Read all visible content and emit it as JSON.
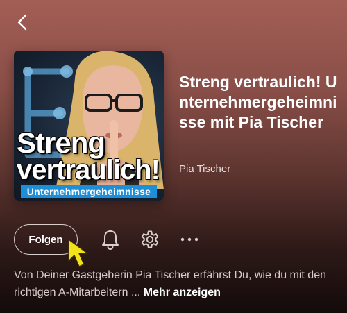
{
  "header": {
    "back_icon": "chevron-left-icon"
  },
  "cover": {
    "title_line1": "Streng",
    "title_line2": "vertraulich!",
    "subtitle": "Unternehmergeheimnisse",
    "band_color": "#1d8fd8"
  },
  "podcast": {
    "title": "Streng vertraulich! Unternehmergeheimnisse mit Pia Tischer",
    "author": "Pia Tischer"
  },
  "actions": {
    "follow_label": "Folgen",
    "bell_icon": "bell-icon",
    "settings_icon": "gear-icon",
    "more_icon": "more-horizontal-icon"
  },
  "description": {
    "text": "Von Deiner Gastgeberin Pia Tischer erfährst Du, wie du mit den richtigen A-Mitarbeitern ... ",
    "more_label": "Mehr anzeigen"
  },
  "colors": {
    "background_top": "#a25e55",
    "background_bottom": "#130b0a",
    "cursor": "#f2e21a"
  }
}
